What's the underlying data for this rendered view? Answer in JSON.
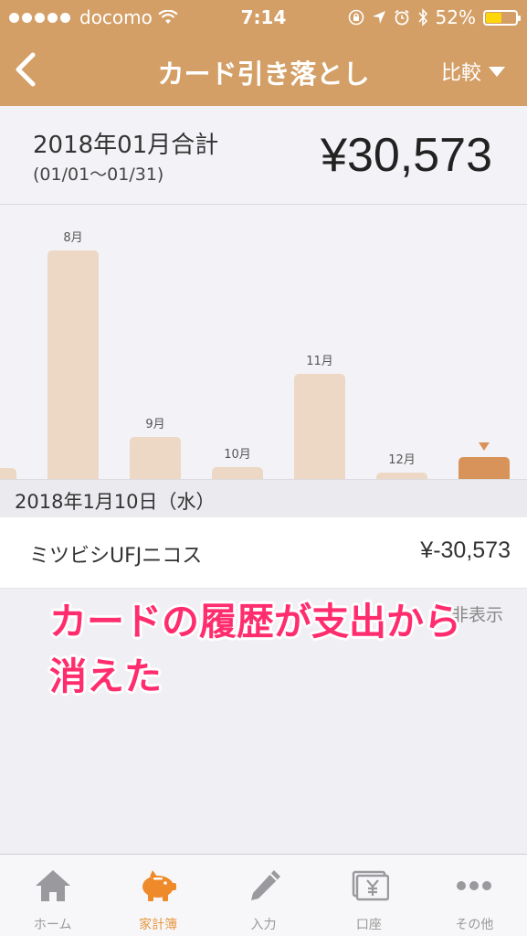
{
  "status_bar": {
    "carrier": "docomo",
    "time": "7:14",
    "battery": "52%"
  },
  "nav": {
    "title": "カード引き落とし",
    "compare_label": "比較"
  },
  "summary": {
    "label": "2018年01月合計",
    "range": "(01/01〜01/31)",
    "total": "¥30,573"
  },
  "chart_data": {
    "type": "bar",
    "categories": [
      "",
      "8月",
      "9月",
      "10月",
      "11月",
      "12月",
      ""
    ],
    "values": [
      12,
      250,
      46,
      13,
      115,
      7,
      24
    ],
    "selected_index": 6,
    "colors": {
      "bar": "#edd8c6",
      "selected": "#d8935a"
    }
  },
  "date_header": "2018年1月10日（水）",
  "transactions": [
    {
      "name": "ミツビシUFJニコス",
      "amount": "¥-30,573"
    }
  ],
  "link_tail": "非表示",
  "annotation": "カードの履歴が支出から消えた",
  "tabs": [
    {
      "label": "ホーム",
      "icon": "home-icon"
    },
    {
      "label": "家計簿",
      "icon": "piggy-bank-icon"
    },
    {
      "label": "入力",
      "icon": "pencil-icon"
    },
    {
      "label": "口座",
      "icon": "yen-account-icon"
    },
    {
      "label": "その他",
      "icon": "more-icon"
    }
  ]
}
